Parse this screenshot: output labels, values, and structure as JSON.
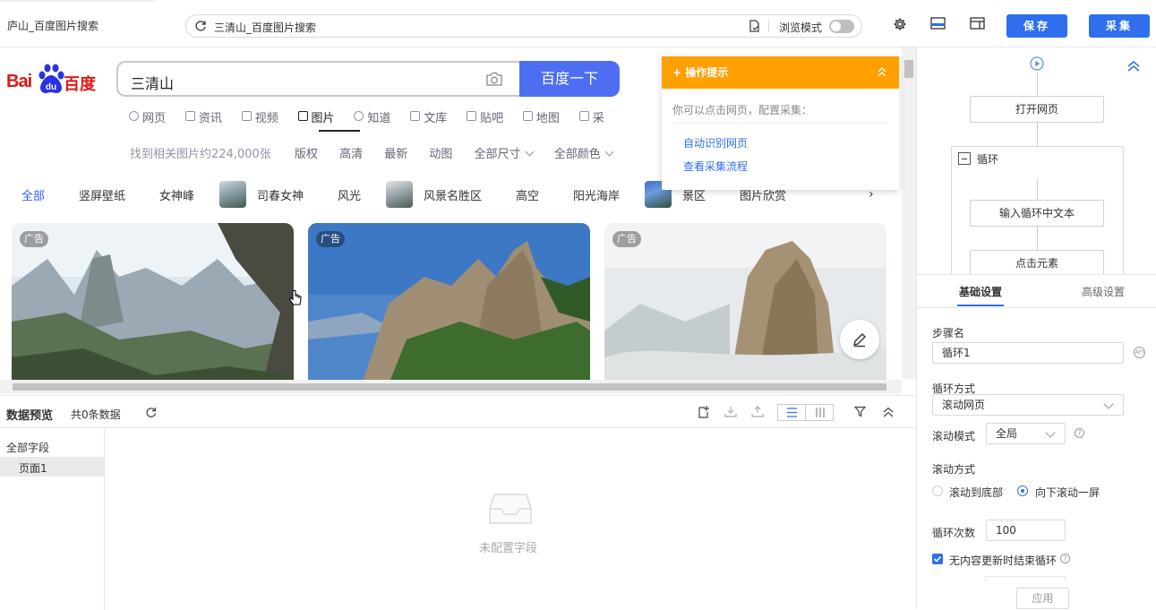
{
  "tab": {
    "title": "庐山_百度图片搜索"
  },
  "address_bar": {
    "text": "三清山_百度图片搜索",
    "browse_mode_label": "浏览模式"
  },
  "toolbar": {
    "save_label": "保存",
    "collect_label": "采集"
  },
  "baidu": {
    "logo_bai": "Bai",
    "logo_du": "百度",
    "search_value": "三清山",
    "search_button": "百度一下",
    "nav_tabs": [
      "网页",
      "资讯",
      "视频",
      "图片",
      "知道",
      "文库",
      "贴吧",
      "地图",
      "采"
    ],
    "active_tab": "图片",
    "result_count": "找到相关图片约224,000张",
    "filters": [
      "版权",
      "高清",
      "最新",
      "动图"
    ],
    "dropdown_filters": [
      "全部尺寸",
      "全部颜色"
    ],
    "chips": {
      "all": "全部",
      "c1": "竖屏壁纸",
      "c2": "女神峰",
      "c3": "司春女神",
      "c4": "风光",
      "c5": "风景名胜区",
      "c6": "高空",
      "c7": "阳光海岸",
      "c8": "景区",
      "c9": "图片欣赏",
      "next": "›"
    },
    "ad_label": "广告"
  },
  "tips_popup": {
    "title": "操作提示",
    "description": "你可以点击网页，配置采集：",
    "links": [
      "自动识别网页",
      "查看采集流程"
    ]
  },
  "data_preview": {
    "title": "数据预览",
    "count": "共0条数据",
    "all_fields": "全部字段",
    "page": "页面1",
    "empty": "未配置字段"
  },
  "flow": {
    "open_page": "打开网页",
    "loop": "循环",
    "input_text": "输入循环中文本",
    "click_element": "点击元素"
  },
  "settings": {
    "tab_basic": "基础设置",
    "tab_advanced": "高级设置",
    "step_name_label": "步骤名",
    "step_name_value": "循环1",
    "loop_mode_label": "循环方式",
    "loop_mode_value": "滚动网页",
    "scroll_mode_label": "滚动模式",
    "scroll_mode_value": "全局",
    "scroll_method_label": "滚动方式",
    "scroll_option_bottom": "滚动到底部",
    "scroll_option_screen": "向下滚动一屏",
    "scroll_option_selected": "向下滚动一屏",
    "loop_count_label": "循环次数",
    "loop_count_value": "100",
    "end_on_no_update_label": "无内容更新时结束循环",
    "end_on_no_update_checked": true,
    "apply_label": "应用"
  },
  "colors": {
    "accent": "#2f6fed",
    "baidu_blue": "#4e6ef2",
    "tips_orange": "#ff9f00",
    "baidu_red": "#de1a14"
  }
}
